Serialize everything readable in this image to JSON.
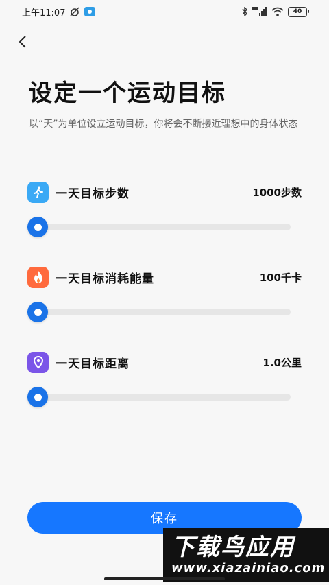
{
  "status_bar": {
    "time": "上午11:07",
    "battery": "40",
    "icons": [
      "alarm-off-icon",
      "app-notification-icon",
      "bluetooth-icon",
      "hd-icon",
      "signal-icon",
      "wifi-icon"
    ]
  },
  "header": {
    "back_icon": "chevron-left-icon",
    "title": "设定一个运动目标",
    "description": "以“天”为单位设立运动目标，你将会不断接近理想中的身体状态"
  },
  "goals": [
    {
      "label": "一天目标步数",
      "value": "1000步数",
      "icon": "walking-icon",
      "icon_color": "#3aa9f5",
      "slider_level": 0
    },
    {
      "label": "一天目标消耗能量",
      "value": "100千卡",
      "icon": "flame-icon",
      "icon_color": "#ff6a3d",
      "slider_level": 0
    },
    {
      "label": "一天目标距离",
      "value": "1.0公里",
      "icon": "location-pin-icon",
      "icon_color": "#7b55e8",
      "slider_level": 0
    }
  ],
  "save_label": "保存",
  "accent_color": "#1677ff",
  "watermark": {
    "title": "下载鸟应用",
    "url": "www.xiazainiao.com"
  }
}
